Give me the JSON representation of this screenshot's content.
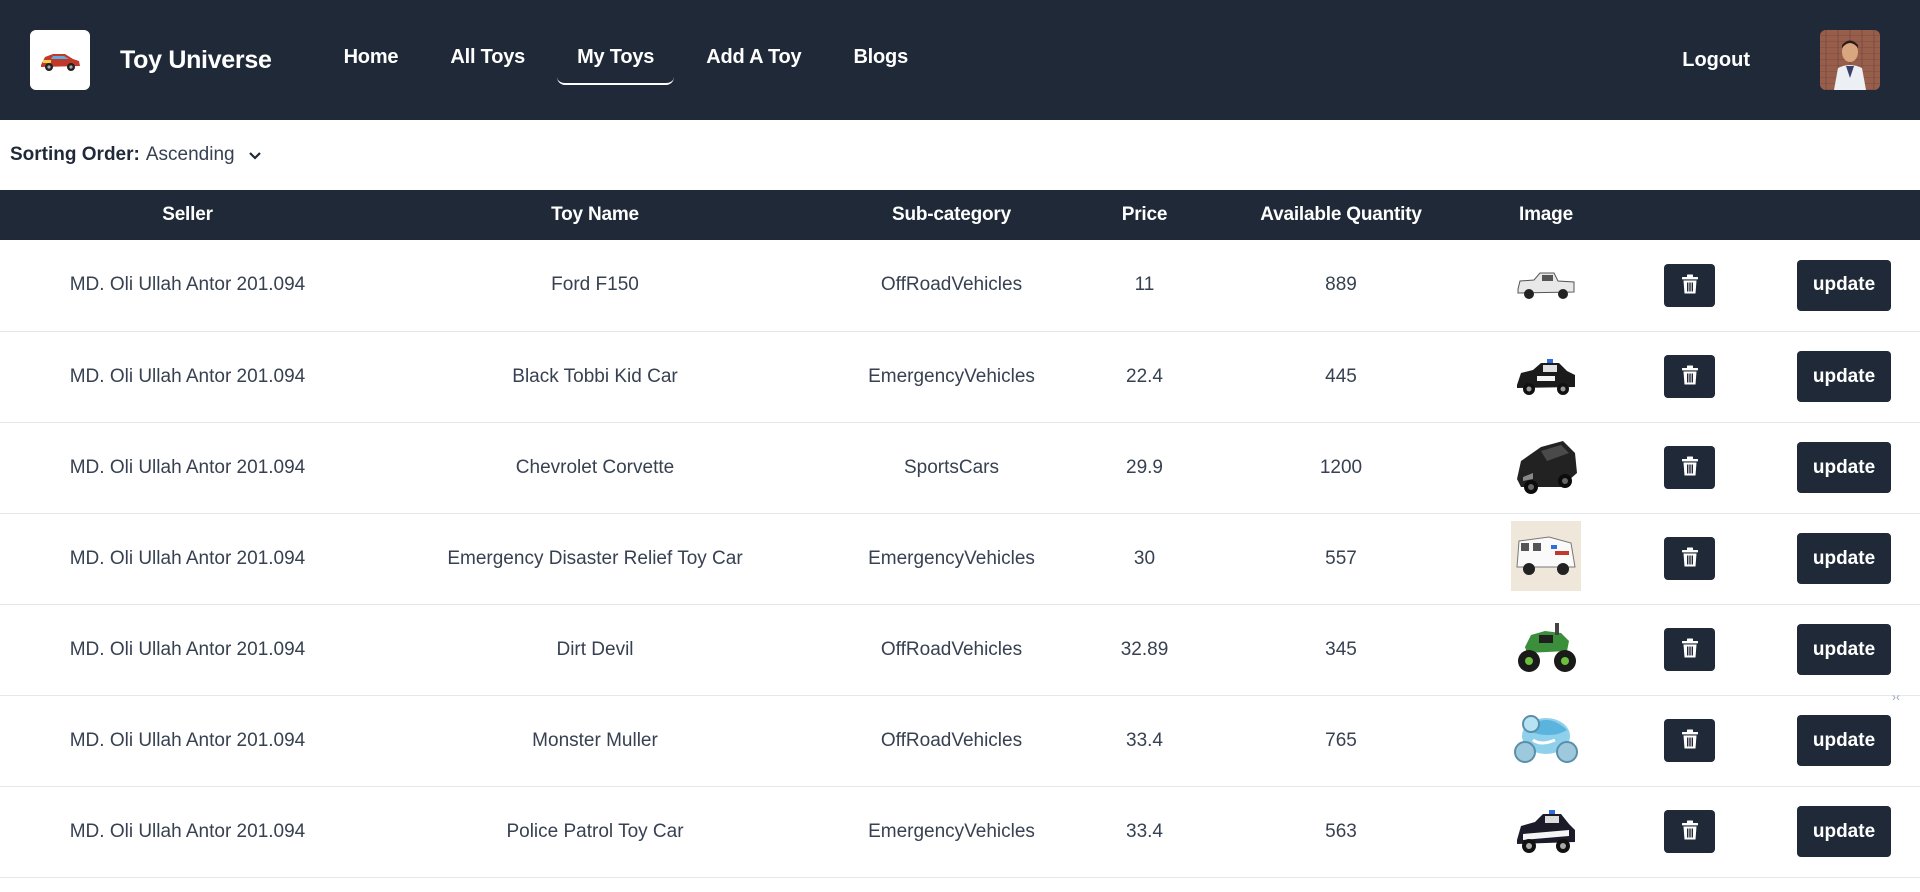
{
  "navbar": {
    "brand": "Toy Universe",
    "links": [
      {
        "label": "Home",
        "active": false
      },
      {
        "label": "All Toys",
        "active": false
      },
      {
        "label": "My Toys",
        "active": true
      },
      {
        "label": "Add A Toy",
        "active": false
      },
      {
        "label": "Blogs",
        "active": false
      }
    ],
    "logout": "Logout"
  },
  "sort": {
    "label": "Sorting Order:",
    "value": "Ascending"
  },
  "table": {
    "headers": [
      "Seller",
      "Toy Name",
      "Sub-category",
      "Price",
      "Available Quantity",
      "Image",
      "",
      ""
    ],
    "update_label": "update",
    "rows": [
      {
        "seller": "MD. Oli Ullah Antor 201.094",
        "name": "Ford F150",
        "sub": "OffRoadVehicles",
        "price": "11",
        "qty": "889",
        "img": "white-pickup-truck"
      },
      {
        "seller": "MD. Oli Ullah Antor 201.094",
        "name": "Black Tobbi Kid Car",
        "sub": "EmergencyVehicles",
        "price": "22.4",
        "qty": "445",
        "img": "police-kid-car"
      },
      {
        "seller": "MD. Oli Ullah Antor 201.094",
        "name": "Chevrolet Corvette",
        "sub": "SportsCars",
        "price": "29.9",
        "qty": "1200",
        "img": "black-sports-car"
      },
      {
        "seller": "MD. Oli Ullah Antor 201.094",
        "name": "Emergency Disaster Relief Toy Car",
        "sub": "EmergencyVehicles",
        "price": "30",
        "qty": "557",
        "img": "ambulance"
      },
      {
        "seller": "MD. Oli Ullah Antor 201.094",
        "name": "Dirt Devil",
        "sub": "OffRoadVehicles",
        "price": "32.89",
        "qty": "345",
        "img": "green-monster-truck"
      },
      {
        "seller": "MD. Oli Ullah Antor 201.094",
        "name": "Monster Muller",
        "sub": "OffRoadVehicles",
        "price": "33.4",
        "qty": "765",
        "img": "blue-stunt-car"
      },
      {
        "seller": "MD. Oli Ullah Antor 201.094",
        "name": "Police Patrol Toy Car",
        "sub": "EmergencyVehicles",
        "price": "33.4",
        "qty": "563",
        "img": "police-patrol-car"
      }
    ]
  },
  "colors": {
    "nav_bg": "#1f2937",
    "button_bg": "#1f2937",
    "text": "#374151"
  },
  "icons": [
    "car-logo-icon",
    "chevron-down-icon",
    "trash-icon",
    "user-avatar"
  ]
}
